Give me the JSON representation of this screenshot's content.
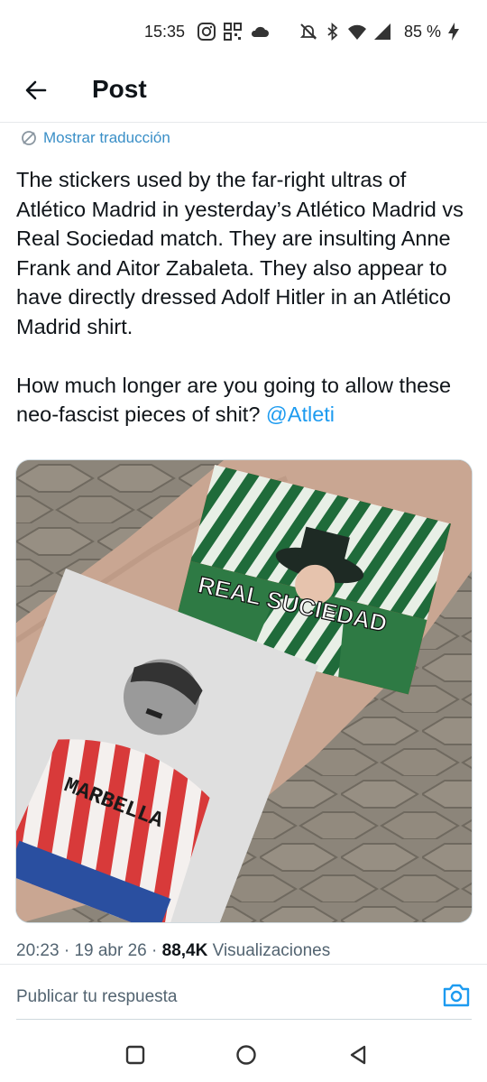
{
  "status_bar": {
    "time": "15:35",
    "battery": "85 %",
    "left_icons": [
      "instagram-icon",
      "qr-icon",
      "cloud-icon"
    ],
    "right_icons": [
      "mute-icon",
      "bluetooth-icon",
      "wifi-icon",
      "signal-icon",
      "charging-icon"
    ]
  },
  "header": {
    "title": "Post",
    "back_icon": "arrow-left-icon"
  },
  "tweet": {
    "translate_label": "Mostrar traducción",
    "text_paragraph_1": "The stickers used by the far-right ultras of Atlético Madrid in yesterday’s Atlético Madrid vs Real Sociedad match. They are insulting Anne Frank and Aitor Zabaleta. They also appear to have directly dressed Adolf Hitler in an Atlético Madrid shirt.",
    "text_paragraph_2": "How much longer are you going to allow these neo-fascist pieces of shit? ",
    "mention": "@Atleti",
    "media_sticker_top_text": "REAL SUCIEDAD",
    "media_sticker_bottom_text": "MARBELLA",
    "time": "20:23",
    "date": "19 abr 26",
    "views_count": "88,4K",
    "views_label": "Visualizaciones"
  },
  "reply": {
    "placeholder": "Publicar tu respuesta",
    "camera_icon": "camera-icon"
  },
  "nav": {
    "icons": [
      "recents-square-icon",
      "home-circle-icon",
      "back-triangle-icon"
    ]
  },
  "colors": {
    "link": "#1d9bf0",
    "text": "#0f1419",
    "secondary": "#536471"
  }
}
